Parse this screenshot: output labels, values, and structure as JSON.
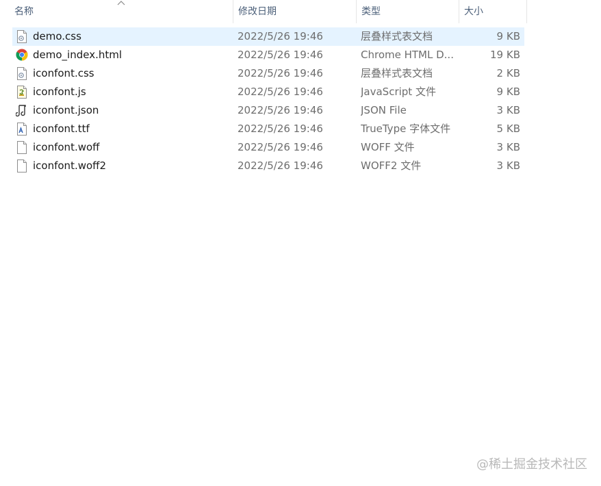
{
  "header": {
    "name_label": "名称",
    "modified_label": "修改日期",
    "type_label": "类型",
    "size_label": "大小"
  },
  "files": [
    {
      "name": "demo.css",
      "modified": "2022/5/26 19:46",
      "type": "层叠样式表文档",
      "size": "9 KB",
      "icon": "css-file-icon",
      "selected": true
    },
    {
      "name": "demo_index.html",
      "modified": "2022/5/26 19:46",
      "type": "Chrome HTML D...",
      "size": "19 KB",
      "icon": "chrome-icon",
      "selected": false
    },
    {
      "name": "iconfont.css",
      "modified": "2022/5/26 19:46",
      "type": "层叠样式表文档",
      "size": "2 KB",
      "icon": "css-file-icon",
      "selected": false
    },
    {
      "name": "iconfont.js",
      "modified": "2022/5/26 19:46",
      "type": "JavaScript 文件",
      "size": "9 KB",
      "icon": "js-file-icon",
      "selected": false
    },
    {
      "name": "iconfont.json",
      "modified": "2022/5/26 19:46",
      "type": "JSON File",
      "size": "3 KB",
      "icon": "json-file-icon",
      "selected": false
    },
    {
      "name": "iconfont.ttf",
      "modified": "2022/5/26 19:46",
      "type": "TrueType 字体文件",
      "size": "5 KB",
      "icon": "font-file-icon",
      "selected": false
    },
    {
      "name": "iconfont.woff",
      "modified": "2022/5/26 19:46",
      "type": "WOFF 文件",
      "size": "3 KB",
      "icon": "blank-file-icon",
      "selected": false
    },
    {
      "name": "iconfont.woff2",
      "modified": "2022/5/26 19:46",
      "type": "WOFF2 文件",
      "size": "3 KB",
      "icon": "blank-file-icon",
      "selected": false
    }
  ],
  "watermark": "@稀土掘金技术社区",
  "colors": {
    "header_text": "#4c607a",
    "selected_row": "#e5f3ff",
    "detail_text": "#6d6d6d"
  }
}
